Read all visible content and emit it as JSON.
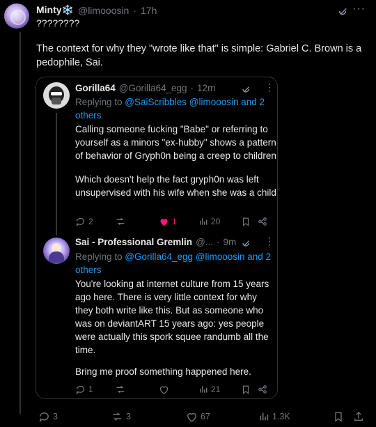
{
  "tweet": {
    "name": "Minty❄️",
    "handle": "@limooosin",
    "time": "17h",
    "line1": "????????",
    "body": "The context for why they \"wrote like that\" is simple: Gabriel C. Brown is a pedophile, Sai.",
    "stats": {
      "replies": "3",
      "retweets": "3",
      "likes": "67",
      "views": "1.3K"
    }
  },
  "quote": {
    "reply1": {
      "name": "Gorilla64",
      "handle": "@Gorilla64_egg",
      "time": "12m",
      "replying_label": "Replying to ",
      "replying_to": "@SaiScribbles @limooosin and 2 others",
      "text1": "Calling someone fucking \"Babe\" or referring to yourself as a minors \"ex-hubby\" shows a pattern of behavior of Gryph0n being a creep to children",
      "text2": "Which doesn't help the fact gryph0n was left unsupervised with his wife when she was a child",
      "stats": {
        "replies": "2",
        "retweets": "",
        "likes": "1",
        "views": "20"
      }
    },
    "reply2": {
      "name": "Sai - Professional Gremlin",
      "handle": "@...",
      "time": "9m",
      "replying_label": "Replying to ",
      "replying_to": "@Gorilla64_egg @limooosin and 2 others",
      "text1": "You're looking at internet culture from 15 years ago here. There is very little context for why they both write like this. But as someone who was on deviantART 15 years ago: yes people were actually this spork squee randumb all the time.",
      "text2": "Bring me proof something happened here.",
      "stats": {
        "replies": "1",
        "retweets": "",
        "likes": "",
        "views": "21"
      }
    }
  },
  "colors": {
    "bg": "#000000",
    "text": "#e7e9ea",
    "muted": "#71767b",
    "link": "#1d9bf0",
    "like": "#f91880",
    "border": "#2f3336"
  }
}
